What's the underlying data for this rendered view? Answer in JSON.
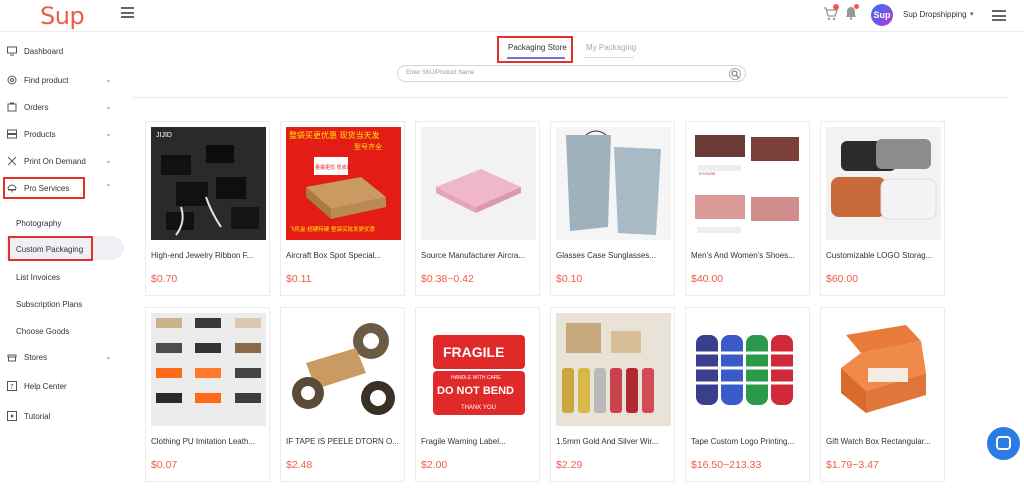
{
  "header": {
    "logo": "Sup",
    "avatar_text": "Sup",
    "user_name": "Sup Dropshipping",
    "caret": "▾"
  },
  "sidebar": {
    "items": [
      {
        "label": "Dashboard",
        "icon": "monitor-icon"
      },
      {
        "label": "Find product",
        "icon": "search-icon"
      },
      {
        "label": "Orders",
        "icon": "bag-icon"
      },
      {
        "label": "Products",
        "icon": "box-icon"
      },
      {
        "label": "Print On Demand",
        "icon": "scissors-icon"
      },
      {
        "label": "Pro Services",
        "icon": "service-icon"
      },
      {
        "label": "Stores",
        "icon": "store-icon"
      },
      {
        "label": "Help Center",
        "icon": "question-icon"
      },
      {
        "label": "Tutorial",
        "icon": "play-icon"
      }
    ],
    "sub_items": [
      "Photography",
      "Custom Packaging",
      "List Invoices",
      "Subscription Plans",
      "Choose Goods"
    ]
  },
  "tabs": [
    "Packaging Store",
    "My Packaging"
  ],
  "search": {
    "placeholder": "Enter SKU/Product Name"
  },
  "products": [
    {
      "title": "High-end Jewelry Ribbon F...",
      "price": "$0.70"
    },
    {
      "title": "Aircraft Box Spot Special...",
      "price": "$0.11"
    },
    {
      "title": "Source Manufacturer Aircra...",
      "price": "$0.38~0.42"
    },
    {
      "title": "Glasses Case Sunglasses...",
      "price": "$0.10"
    },
    {
      "title": "Men's And Women's Shoes...",
      "price": "$40.00"
    },
    {
      "title": "Customizable LOGO Storag...",
      "price": "$60.00"
    },
    {
      "title": "Clothing PU Imitation Leath...",
      "price": "$0.07"
    },
    {
      "title": "IF TAPE IS PEELE DTORN O...",
      "price": "$2.48"
    },
    {
      "title": "Fragile Warning Label...",
      "price": "$2.00"
    },
    {
      "title": "1.5mm Gold And Silver Wir...",
      "price": "$2.29"
    },
    {
      "title": "Tape Custom Logo Printing...",
      "price": "$16.50~213.33"
    },
    {
      "title": "Gift Watch Box Rectangular...",
      "price": "$1.79~3.47"
    }
  ],
  "image_text": {
    "jewelry_brand": "JIJID",
    "aircraft_banner_1": "整袋买更优惠  现货当天发",
    "aircraft_banner_2": "型号齐全",
    "aircraft_mid": "量袋更优 惯收邮包",
    "aircraft_bottom": "飞机盒  超硬特硬  整袋买批发更优惠",
    "fragile_1": "FRAGILE",
    "fragile_2": "HANDLE WITH CARE",
    "fragile_3": "DO NOT BEND",
    "fragile_4": "THANK YOU",
    "shoe_brand": "EYOUSE"
  },
  "colors": {
    "accent": "#f05a4a",
    "highlight": "#e0322b",
    "tab_active": "#7b6fd6",
    "chat": "#2b7be5"
  }
}
